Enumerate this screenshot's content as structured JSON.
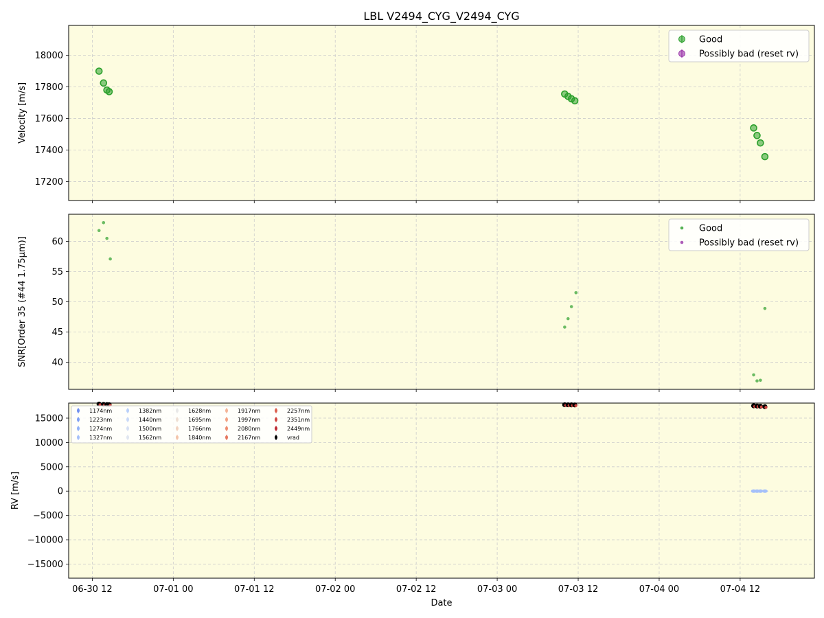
{
  "title": "LBL V2494_CYG_V2494_CYG",
  "colors": {
    "good": "#2ca02c",
    "bad": "#9932a8",
    "bg": "#fdfce0",
    "grid": "#cccccc"
  },
  "chart_data": [
    {
      "type": "scatter",
      "ylabel": "Velocity [m/s]",
      "ylim": [
        17080,
        18190
      ],
      "yticks": [
        17200,
        17400,
        17600,
        17800,
        18000
      ],
      "legend": {
        "placement": "top-right",
        "entries": [
          "Good",
          "Possibly bad (reset rv)"
        ]
      },
      "series": [
        {
          "name": "Good",
          "x": [
            "2024-06-30 13:00",
            "2024-06-30 13:40",
            "2024-06-30 14:10",
            "2024-06-30 14:30",
            "2024-07-03 10:00",
            "2024-07-03 10:30",
            "2024-07-03 11:00",
            "2024-07-03 11:30",
            "2024-07-04 14:00",
            "2024-07-04 14:30",
            "2024-07-04 15:00",
            "2024-07-04 15:40"
          ],
          "y": [
            17900,
            17825,
            17780,
            17770,
            17755,
            17740,
            17725,
            17712,
            17540,
            17492,
            17445,
            17358
          ]
        },
        {
          "name": "Possibly bad (reset rv)",
          "x": [],
          "y": []
        }
      ]
    },
    {
      "type": "scatter",
      "ylabel": "SNR[Order 35 (#44 1.75μm)]",
      "ylim": [
        35.5,
        64.5
      ],
      "yticks": [
        40,
        45,
        50,
        55,
        60
      ],
      "legend": {
        "placement": "top-right",
        "entries": [
          "Good",
          "Possibly bad (reset rv)"
        ]
      },
      "series": [
        {
          "name": "Good",
          "x": [
            "2024-06-30 13:00",
            "2024-06-30 13:40",
            "2024-06-30 14:10",
            "2024-06-30 14:40",
            "2024-07-03 10:00",
            "2024-07-03 10:30",
            "2024-07-03 11:00",
            "2024-07-03 11:40",
            "2024-07-04 14:00",
            "2024-07-04 14:30",
            "2024-07-04 15:00",
            "2024-07-04 15:40"
          ],
          "y": [
            61.8,
            63.1,
            60.5,
            57.1,
            45.8,
            47.2,
            49.2,
            51.5,
            37.9,
            36.9,
            37.0,
            48.9
          ]
        },
        {
          "name": "Possibly bad (reset rv)",
          "x": [],
          "y": []
        }
      ]
    },
    {
      "type": "scatter",
      "ylabel": "RV [m/s]",
      "xlabel": "Date",
      "ylim": [
        -17900,
        18100
      ],
      "yticks": [
        -15000,
        -10000,
        -5000,
        0,
        5000,
        10000,
        15000
      ],
      "ytick_labels": [
        "−15000",
        "−10000",
        "−5000",
        "0",
        "5000",
        "10000",
        "15000"
      ],
      "legend": {
        "placement": "top-left",
        "entries": [
          "1174nm",
          "1223nm",
          "1274nm",
          "1327nm",
          "1382nm",
          "1440nm",
          "1500nm",
          "1562nm",
          "1628nm",
          "1695nm",
          "1766nm",
          "1840nm",
          "1917nm",
          "1997nm",
          "2080nm",
          "2167nm",
          "2257nm",
          "2351nm",
          "2449nm",
          "vrad"
        ],
        "entry_colors": [
          "#6f8ff0",
          "#7fa0f5",
          "#92b2f8",
          "#a5c0fa",
          "#b8cffa",
          "#c8d9f8",
          "#d6e0f4",
          "#e0e6f0",
          "#e8e8e8",
          "#eedfd3",
          "#f2d3c0",
          "#f4c4aa",
          "#f4b497",
          "#f3a283",
          "#ee8d70",
          "#e6775e",
          "#dc5f4e",
          "#cf4540",
          "#bd2a33",
          "#000000"
        ]
      },
      "series": [
        {
          "name": "vrad",
          "x": [
            "2024-06-30 13:00",
            "2024-06-30 13:40",
            "2024-06-30 14:10",
            "2024-06-30 14:30",
            "2024-07-03 10:00",
            "2024-07-03 10:30",
            "2024-07-03 11:00",
            "2024-07-03 11:30",
            "2024-07-04 14:00",
            "2024-07-04 14:30",
            "2024-07-04 15:00",
            "2024-07-04 15:40"
          ],
          "y": [
            17900,
            17825,
            17780,
            17770,
            17755,
            17740,
            17725,
            17712,
            17540,
            17492,
            17445,
            17358
          ]
        },
        {
          "name": "1562nm",
          "x": [
            "2024-07-04 14:00",
            "2024-07-04 14:30",
            "2024-07-04 15:00",
            "2024-07-04 15:40"
          ],
          "y": [
            0,
            0,
            0,
            0
          ]
        }
      ]
    }
  ],
  "x_axis": {
    "label": "Date",
    "range": [
      "2024-06-30 08:30",
      "2024-07-04 23:00"
    ],
    "ticks": [
      "2024-06-30 12:00",
      "2024-07-01 00:00",
      "2024-07-01 12:00",
      "2024-07-02 00:00",
      "2024-07-02 12:00",
      "2024-07-03 00:00",
      "2024-07-03 12:00",
      "2024-07-04 00:00",
      "2024-07-04 12:00"
    ],
    "tick_labels": [
      "06-30 12",
      "07-01 00",
      "07-01 12",
      "07-02 00",
      "07-02 12",
      "07-03 00",
      "07-03 12",
      "07-04 00",
      "07-04 12"
    ]
  }
}
